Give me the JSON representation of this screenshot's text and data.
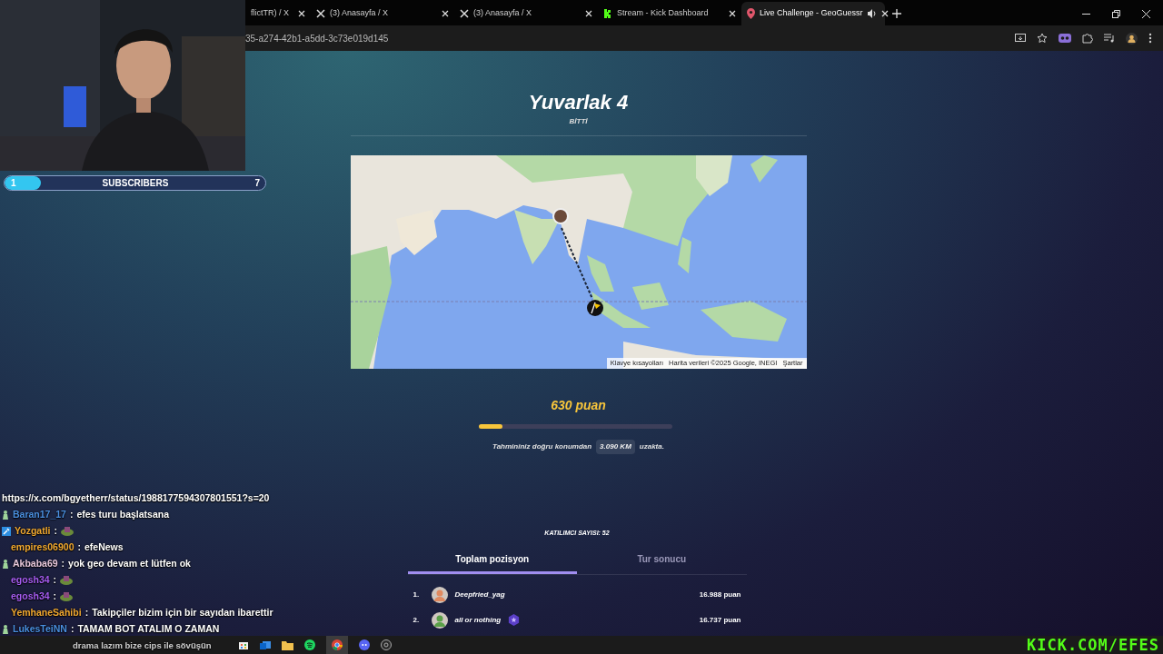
{
  "browser": {
    "tabs": [
      {
        "title": "flictTR) / X",
        "kind": "plain",
        "selected": false,
        "audio": false
      },
      {
        "title": "(3) Anasayfa / X",
        "kind": "x",
        "selected": false,
        "audio": false
      },
      {
        "title": "(3) Anasayfa / X",
        "kind": "x",
        "selected": false,
        "audio": false
      },
      {
        "title": "Stream - Kick Dashboard",
        "kind": "kick",
        "selected": false,
        "audio": false
      },
      {
        "title": "Live Challenge - GeoGuessr",
        "kind": "pin",
        "selected": true,
        "audio": true
      }
    ],
    "address": "35-a274-42b1-a5dd-3c73e019d145"
  },
  "subscriber_goal": {
    "current": "1",
    "label": "SUBSCRIBERS",
    "target": "7",
    "level": 0.14
  },
  "round": {
    "title": "Yuvarlak 4",
    "status": "BİTTİ",
    "map_footer": [
      "Klavye kısayolları",
      "Harita verileri ©2025 Google, INEGI",
      "Şartlar"
    ],
    "score": "630 puan",
    "level": 0.12,
    "distance_before": "Tahmininiz doğru konumdan",
    "distance": "3.090 KM",
    "distance_after": "uzakta.",
    "participants": "KATILIMCI SAYISI: 52",
    "tabs": [
      {
        "label": "Toplam pozisyon",
        "selected": true
      },
      {
        "label": "Tur sonucu",
        "selected": false
      }
    ],
    "leaderboard": [
      {
        "rank": "1.",
        "name": "Deepfried_yag",
        "score": "16.988 puan",
        "badge": false
      },
      {
        "rank": "2.",
        "name": "all or nothing",
        "score": "16.737 puan",
        "badge": true
      }
    ]
  },
  "chat": [
    {
      "kind": "link",
      "text": "https://x.com/bgyetherr/status/1988177594307801551?s=20"
    },
    {
      "kind": "message",
      "badge": {
        "kind": "figure"
      },
      "user": "Baran17_17",
      "color": "#4a8fe0",
      "separator": ":",
      "text": "efes turu başlatsana"
    },
    {
      "kind": "emote",
      "badge": {
        "kind": "square"
      },
      "user": "Yozgatli",
      "color": "#f0a830",
      "separator": ":"
    },
    {
      "kind": "message",
      "user": "empires06900",
      "color": "#f0a830",
      "separator": ":",
      "text": "efeNews"
    },
    {
      "kind": "message",
      "badge": {
        "kind": "figure"
      },
      "user": "Akbaba69",
      "color": "#e8c8dc",
      "separator": ":",
      "text": "yok geo devam et lütfen ok"
    },
    {
      "kind": "emote",
      "user": "egosh34",
      "color": "#a65cf0",
      "separator": ":"
    },
    {
      "kind": "emote",
      "user": "egosh34",
      "color": "#a65cf0",
      "separator": ":"
    },
    {
      "kind": "message",
      "user": "YemhaneSahibi",
      "color": "#f0a830",
      "separator": ":",
      "text": "Takipçiler bizim için bir sayıdan ibarettir"
    },
    {
      "kind": "message",
      "badge": {
        "kind": "figure"
      },
      "user": "LukesTeiNN",
      "color": "#4a8fe0",
      "separator": ":",
      "text": "TAMAM BOT ATALIM O ZAMAN"
    },
    {
      "kind": "plain",
      "text": "drama lazım bize cips ile sövüşün"
    }
  ],
  "overlay_logo": "KICK.COM/EFES"
}
